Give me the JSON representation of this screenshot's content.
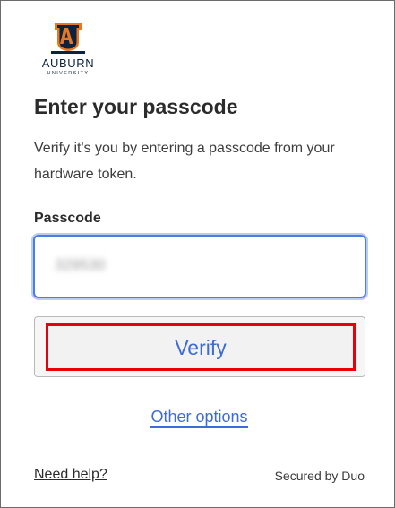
{
  "brand": {
    "wordmark": "AUBURN",
    "subtitle": "UNIVERSITY",
    "primary_color": "#0c2340",
    "accent_color": "#e87722"
  },
  "page": {
    "title": "Enter your passcode",
    "description": "Verify it's you by entering a passcode from your hardware token."
  },
  "form": {
    "passcode_label": "Passcode",
    "passcode_value": "329530",
    "verify_label": "Verify"
  },
  "links": {
    "other_options": "Other options",
    "need_help": "Need help?"
  },
  "footer": {
    "secured_by": "Secured by Duo"
  },
  "colors": {
    "link": "#3f6bd4",
    "highlight_border": "#e8000b",
    "input_focus": "#4a7ee0"
  }
}
